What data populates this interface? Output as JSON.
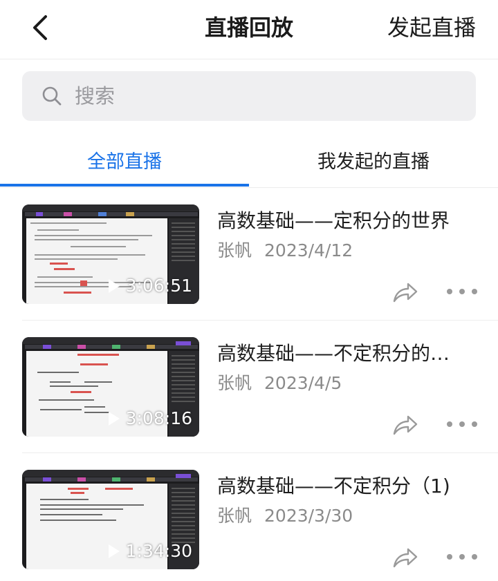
{
  "header": {
    "title": "直播回放",
    "action_label": "发起直播"
  },
  "search": {
    "placeholder": "搜索"
  },
  "tabs": [
    {
      "label": "全部直播",
      "active": true
    },
    {
      "label": "我发起的直播",
      "active": false
    }
  ],
  "colors": {
    "accent": "#1a73e8",
    "secondary_text": "#8a8a8a"
  },
  "recordings": [
    {
      "title": "高数基础——定积分的世界",
      "author": "张帆",
      "date": "2023/4/12",
      "duration": "3:06:51"
    },
    {
      "title": "高数基础——不定积分的…",
      "author": "张帆",
      "date": "2023/4/5",
      "duration": "3:08:16"
    },
    {
      "title": "高数基础——不定积分（1)",
      "author": "张帆",
      "date": "2023/3/30",
      "duration": "1:34:30"
    }
  ],
  "icons": {
    "back": "chevron-left-icon",
    "search": "search-icon",
    "share": "share-icon",
    "more": "more-horizontal-icon",
    "play": "play-icon"
  }
}
